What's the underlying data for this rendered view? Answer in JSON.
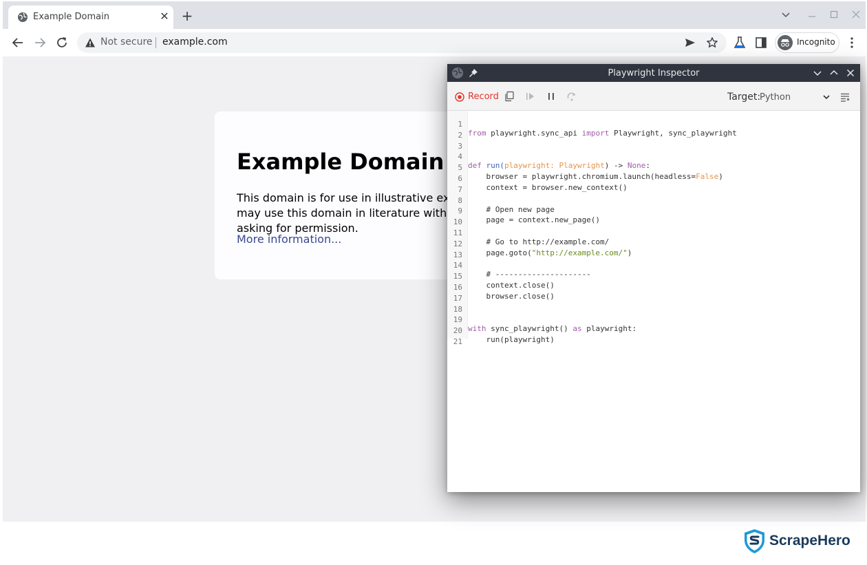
{
  "browser": {
    "tab_title": "Example Domain",
    "security_label": "Not secure",
    "url": "example.com",
    "profile_label": "Incognito"
  },
  "page": {
    "heading": "Example Domain",
    "paragraph": "This domain is for use in illustrative examples in documents. You may use this domain in literature without prior coordination or asking for permission.",
    "link": "More information..."
  },
  "inspector": {
    "title": "Playwright Inspector",
    "record_label": "Record",
    "target_label": "Target:",
    "target_value": "Python",
    "code_lines": [
      {
        "n": "1"
      },
      {
        "n": "2"
      },
      {
        "n": "3"
      },
      {
        "n": "4"
      },
      {
        "n": "5"
      },
      {
        "n": "6"
      },
      {
        "n": "7"
      },
      {
        "n": "8"
      },
      {
        "n": "9"
      },
      {
        "n": "10"
      },
      {
        "n": "11"
      },
      {
        "n": "12"
      },
      {
        "n": "13"
      },
      {
        "n": "14"
      },
      {
        "n": "15"
      },
      {
        "n": "16"
      },
      {
        "n": "17"
      },
      {
        "n": "18"
      },
      {
        "n": "19"
      },
      {
        "n": "20"
      },
      {
        "n": "21"
      }
    ],
    "code": {
      "l1": {
        "a": "from",
        "b": " playwright.sync_api ",
        "c": "import",
        "d": " Playwright, sync_playwright"
      },
      "l4": {
        "a": "def",
        "b": " ",
        "c": "run",
        "d": "(",
        "e": "playwright: Playwright",
        "f": ") -> ",
        "g": "None",
        "h": ":"
      },
      "l5": {
        "a": "    browser = playwright.chromium.launch(headless=",
        "b": "False",
        "c": ")"
      },
      "l6": "    context = browser.new_context()",
      "l8": "    # Open new page",
      "l9": "    page = context.new_page()",
      "l11": "    # Go to http://example.com/",
      "l12": {
        "a": "    page.goto(",
        "b": "\"http://example.com/\"",
        "c": ")"
      },
      "l14": "    # ---------------------",
      "l15": "    context.close()",
      "l16": "    browser.close()",
      "l19": {
        "a": "with",
        "b": " sync_playwright() ",
        "c": "as",
        "d": " playwright:"
      },
      "l20": "    run(playwright)"
    }
  },
  "watermark": {
    "brand": "ScrapeHero"
  },
  "colors": {
    "record": "#e5322d",
    "link": "#38488f",
    "brand": "#1a3a5c",
    "brand_accent": "#1e9ad6"
  }
}
